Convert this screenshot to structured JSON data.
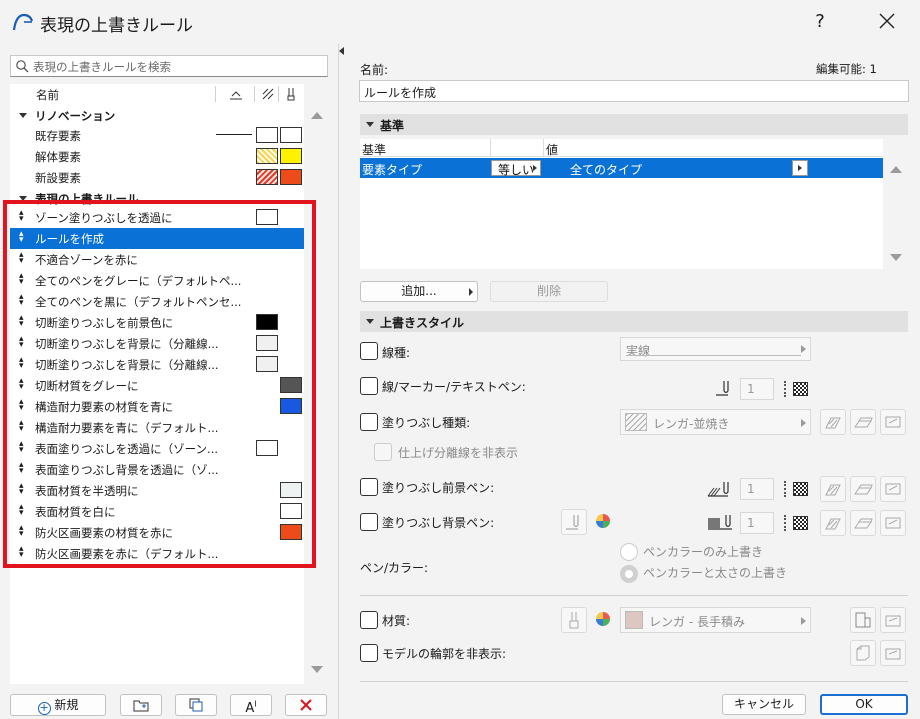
{
  "window": {
    "title": "表現の上書きルール",
    "help": "?"
  },
  "search": {
    "placeholder": "表現の上書きルールを検索"
  },
  "list": {
    "header_name": "名前",
    "group_renovation": "リノベーション",
    "renovation_items": [
      "既存要素",
      "解体要素",
      "新設要素"
    ],
    "group_rules": "表現の上書きルール",
    "rules": [
      "ゾーン塗りつぶしを透過に",
      "ルールを作成",
      "不適合ゾーンを赤に",
      "全てのペンをグレーに（デフォルトペ...",
      "全てのペンを黒に（デフォルトペンセ...",
      "切断塗りつぶしを前景色に",
      "切断塗りつぶしを背景に（分離線...",
      "切断塗りつぶしを背景に（分離線...",
      "切断材質をグレーに",
      "構造耐力要素の材質を青に",
      "構造耐力要素を青に（デフォルト...",
      "表面塗りつぶしを透過に（ゾーン...",
      "表面塗りつぶし背景を透過に（ゾ...",
      "表面材質を半透明に",
      "表面材質を白に",
      "防火区画要素の材質を赤に",
      "防火区画要素を赤に（デフォルト..."
    ],
    "selected_index": 1
  },
  "bottom_buttons": {
    "new": "新規"
  },
  "name": {
    "label": "名前:",
    "editable": "編集可能: 1",
    "value": "ルールを作成"
  },
  "criteria": {
    "section": "基準",
    "col_criterion": "基準",
    "col_value": "値",
    "row_type": "要素タイプ",
    "row_op": "等しい",
    "row_value": "全てのタイプ",
    "add": "追加...",
    "delete": "削除"
  },
  "style": {
    "section": "上書きスタイル",
    "line_type": "線種:",
    "line_type_value": "実線",
    "line_pen": "線/マーカー/テキストペン:",
    "fill_type": "塗りつぶし種類:",
    "fill_type_value": "レンガ-並焼き",
    "hide_sep": "仕上げ分離線を非表示",
    "fill_fg": "塗りつぶし前景ペン:",
    "fill_bg": "塗りつぶし背景ペン:",
    "pen_color": "ペン/カラー:",
    "radio1": "ペンカラーのみ上書き",
    "radio2": "ペンカラーと太さの上書き",
    "material": "材質:",
    "material_value": "レンガ - 長手積み",
    "hide_contour": "モデルの輪郭を非表示:",
    "pen_number": "1"
  },
  "footer": {
    "cancel": "キャンセル",
    "ok": "OK"
  },
  "colors": {
    "accent": "#0a72d6",
    "highlight": "#e0141e"
  }
}
